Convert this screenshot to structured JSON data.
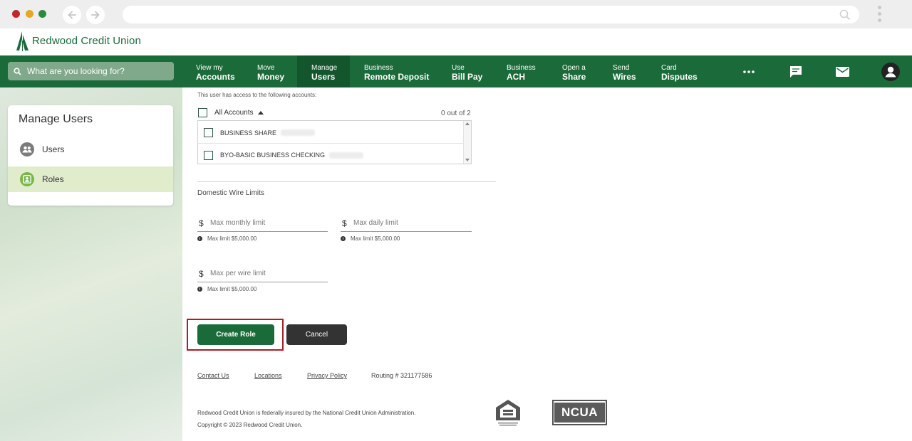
{
  "brand": {
    "name": "Redwood Credit Union",
    "colors": {
      "primary": "#1b6b3a",
      "active_nav": "#13562e",
      "highlight": "#a81e25",
      "roles_bg": "#e1eccd"
    }
  },
  "header": {
    "search_placeholder": "What are you looking for?",
    "nav": [
      {
        "line1": "View my",
        "line2": "Accounts"
      },
      {
        "line1": "Move",
        "line2": "Money"
      },
      {
        "line1": "Manage",
        "line2": "Users"
      },
      {
        "line1": "Business",
        "line2": "Remote Deposit"
      },
      {
        "line1": "Use",
        "line2": "Bill Pay"
      },
      {
        "line1": "Business",
        "line2": "ACH"
      },
      {
        "line1": "Open a",
        "line2": "Share"
      },
      {
        "line1": "Send",
        "line2": "Wires"
      },
      {
        "line1": "Card",
        "line2": "Disputes"
      }
    ],
    "icons": [
      "more-icon",
      "chat-icon",
      "mail-icon",
      "profile-icon"
    ]
  },
  "sidebar": {
    "title": "Manage Users",
    "items": [
      {
        "label": "Users",
        "icon": "users-icon"
      },
      {
        "label": "Roles",
        "icon": "roles-icon"
      }
    ]
  },
  "form": {
    "access_note": "This user has access to the following accounts:",
    "all_accounts": "All Accounts",
    "count": "0 out of 2",
    "accounts": [
      {
        "name": "BUSINESS SHARE",
        "checked": false
      },
      {
        "name": "BYO-BASIC BUSINESS CHECKING",
        "checked": false
      }
    ],
    "section_title": "Domestic Wire Limits",
    "currency_symbol": "$",
    "fields": {
      "monthly_placeholder": "Max monthly limit",
      "daily_placeholder": "Max daily limit",
      "wire_placeholder": "Max per wire limit",
      "hint": "Max limit $5,000.00"
    },
    "create_button": "Create Role",
    "cancel_button": "Cancel"
  },
  "footer": {
    "links": [
      "Contact Us",
      "Locations",
      "Privacy Policy"
    ],
    "routing": "Routing # 321177586",
    "insured": "Redwood Credit Union is federally insured by the National Credit Union Administration.",
    "copyright": "Copyright © 2023 Redwood Credit Union.",
    "ncua_logo": "NCUA"
  }
}
